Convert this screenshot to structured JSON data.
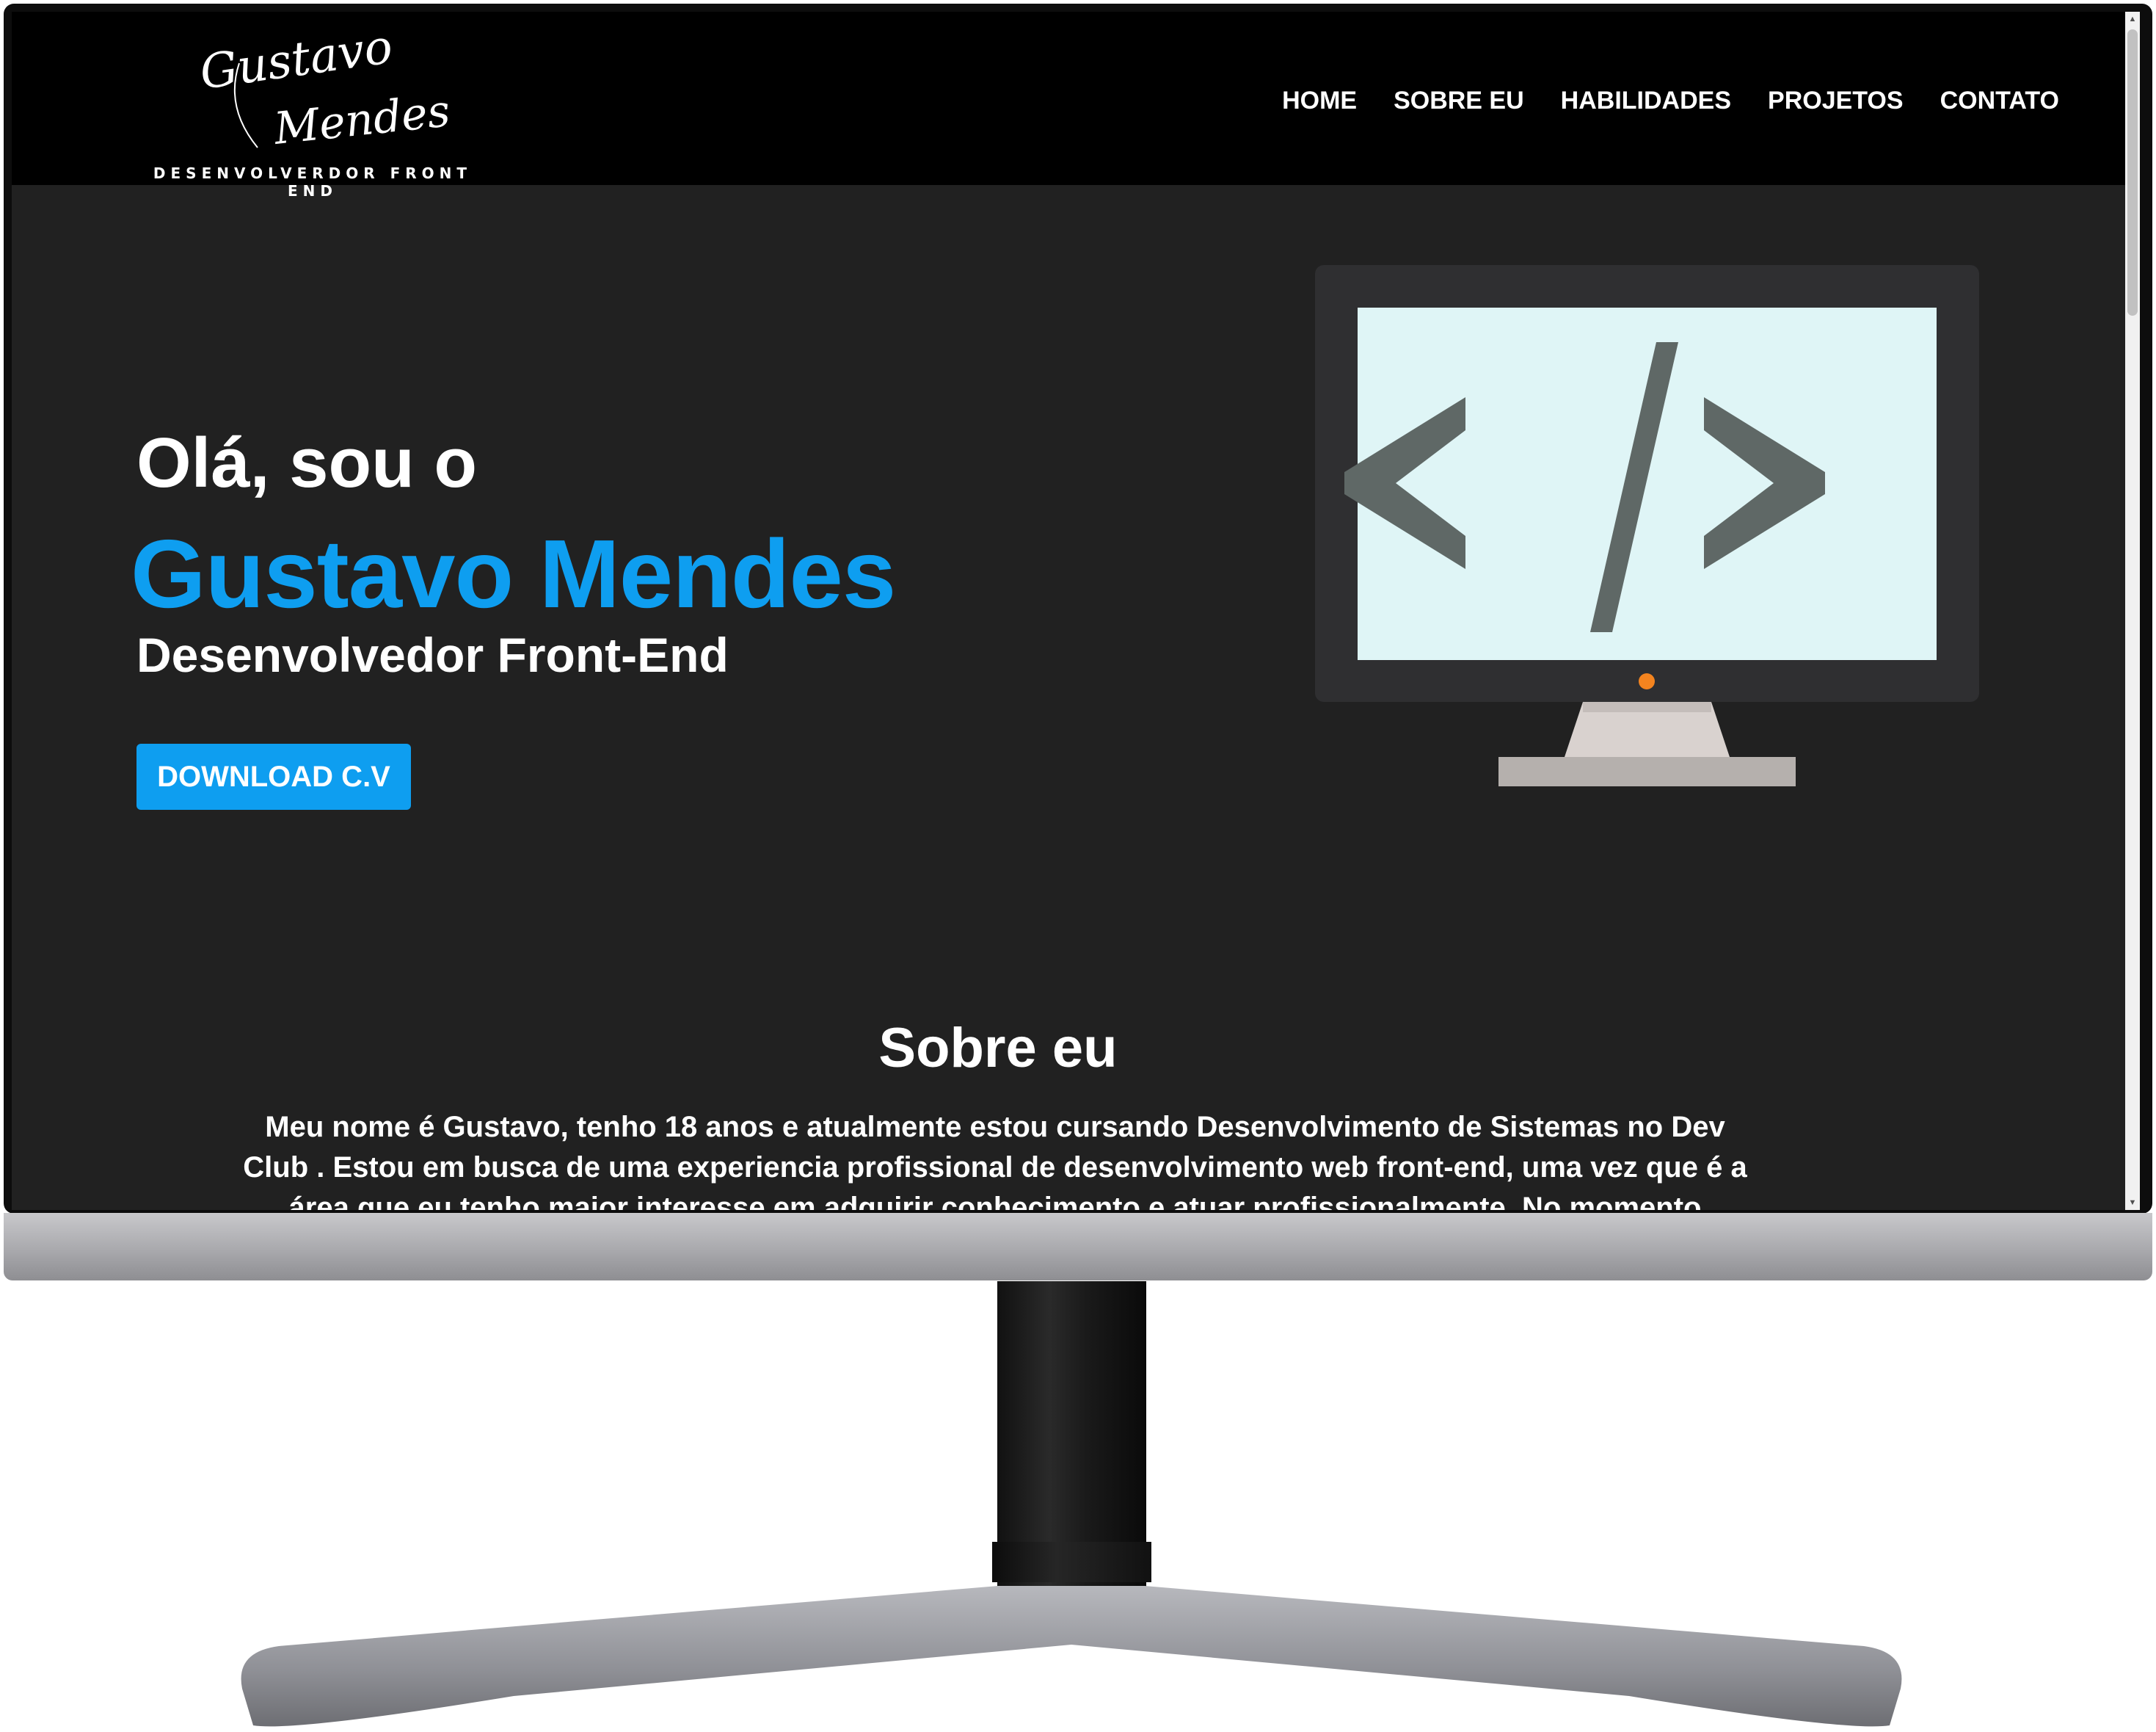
{
  "logo": {
    "script_first": "Gustavo",
    "script_last": "Mendes",
    "subtitle": "DESENVOLVERDOR FRONT END"
  },
  "nav": {
    "items": [
      "HOME",
      "SOBRE EU",
      "HABILIDADES",
      "PROJETOS",
      "CONTATO"
    ]
  },
  "hero": {
    "greeting": "Olá, sou o",
    "name": "Gustavo Mendes",
    "role": "Desenvolvedor Front-End",
    "download_label": "DOWNLOAD C.V"
  },
  "illustration": {
    "code_symbol": "</>",
    "icon": "computer-code-icon"
  },
  "about": {
    "title": "Sobre eu",
    "paragraph": "Meu nome é Gustavo, tenho 18 anos e atualmente estou cursando Desenvolvimento de Sistemas no Dev Club . Estou em busca de uma experiencia profissional de desenvolvimento web front-end, uma vez que é a área que eu tenho maior interesse em adquirir conhecimento e atuar profissionalmente. No momento"
  },
  "colors": {
    "accent": "#0e9ef0",
    "header_bg": "#000000",
    "page_bg": "#212121",
    "text": "#ffffff"
  }
}
